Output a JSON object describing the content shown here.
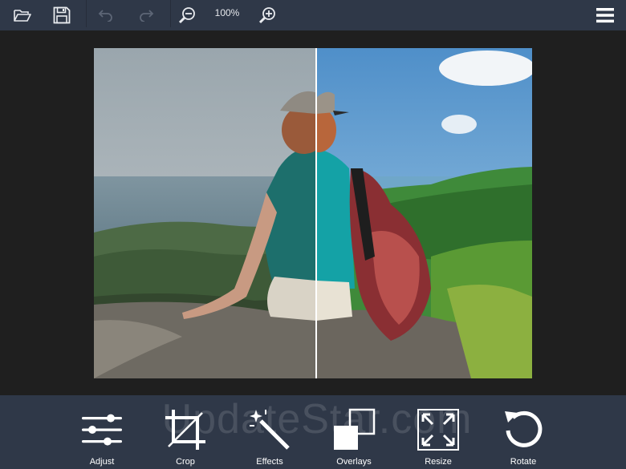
{
  "toolbar": {
    "open_icon": "folder-open-icon",
    "save_icon": "floppy-disk-icon",
    "undo_icon": "undo-icon",
    "redo_icon": "redo-icon",
    "zoom_out_icon": "zoom-out-icon",
    "zoom_level": "100%",
    "zoom_in_icon": "zoom-in-icon",
    "menu_icon": "hamburger-menu-icon"
  },
  "tools": [
    {
      "label": "Adjust",
      "icon": "sliders-icon"
    },
    {
      "label": "Crop",
      "icon": "crop-icon"
    },
    {
      "label": "Effects",
      "icon": "magic-wand-icon"
    },
    {
      "label": "Overlays",
      "icon": "overlay-squares-icon"
    },
    {
      "label": "Resize",
      "icon": "resize-arrows-icon"
    },
    {
      "label": "Rotate",
      "icon": "rotate-icon"
    }
  ],
  "watermark": "UpdateStar.com",
  "colors": {
    "toolbar_bg": "#2f3848",
    "workarea_bg": "#1f1f1f",
    "icon": "#ffffff",
    "icon_disabled": "#5d6676"
  }
}
